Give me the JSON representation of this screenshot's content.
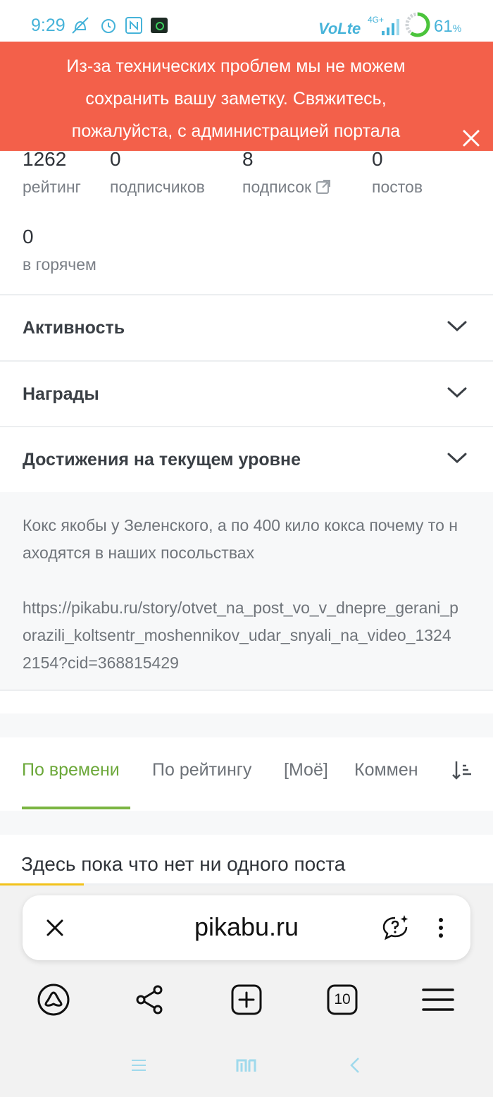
{
  "status_bar": {
    "time": "9:29",
    "battery": "61",
    "battery_unit": "%"
  },
  "banner": {
    "message": "Из-за технических проблем мы не можем сохранить вашу заметку. Свяжитесь, пожалуйста, с администрацией портала"
  },
  "stats": [
    {
      "value": "1262",
      "label": "рейтинг"
    },
    {
      "value": "0",
      "label": "подписчиков"
    },
    {
      "value": "8",
      "label": "подписок"
    },
    {
      "value": "0",
      "label": "постов"
    },
    {
      "value": "0",
      "label": "в горячем"
    }
  ],
  "sections": [
    {
      "title": "Активность"
    },
    {
      "title": "Награды"
    },
    {
      "title": "Достижения на текущем уровне"
    }
  ],
  "note": {
    "line1": "Кокс якобы у Зеленского, а по 400 кило кокса почему то находятся в наших посольствах",
    "line2": "https://pikabu.ru/story/otvet_na_post_vo_v_dnepre_gerani_porazili_koltsentr_moshennikov_udar_snyali_na_video_13242154?cid=368815429"
  },
  "tabs": [
    {
      "label": "По времени",
      "active": true
    },
    {
      "label": "По рейтингу",
      "active": false
    },
    {
      "label": "[Моё]",
      "active": false
    },
    {
      "label": "Коммен",
      "active": false
    }
  ],
  "empty_message": "Здесь пока что нет ни одного поста",
  "page_load_progress": 0.17,
  "browser": {
    "url": "pikabu.ru",
    "tab_count": "10"
  },
  "colors": {
    "banner": "#f3604a",
    "accent_green": "#7bb542",
    "status_blue": "#46b3d9",
    "progress_yellow": "#f2c21b"
  },
  "icons": [
    "do-not-disturb-icon",
    "alarm-icon",
    "nfc-icon",
    "terminal-app-icon",
    "volte-icon",
    "signal-icon",
    "battery-ring-icon",
    "close-icon",
    "external-link-icon",
    "chevron-down-icon",
    "sort-icon",
    "ai-chat-icon",
    "more-vertical-icon",
    "alice-icon",
    "share-icon",
    "new-tab-icon",
    "tabs-icon",
    "menu-icon",
    "nav-menu-icon",
    "nav-home-icon",
    "nav-back-icon"
  ]
}
